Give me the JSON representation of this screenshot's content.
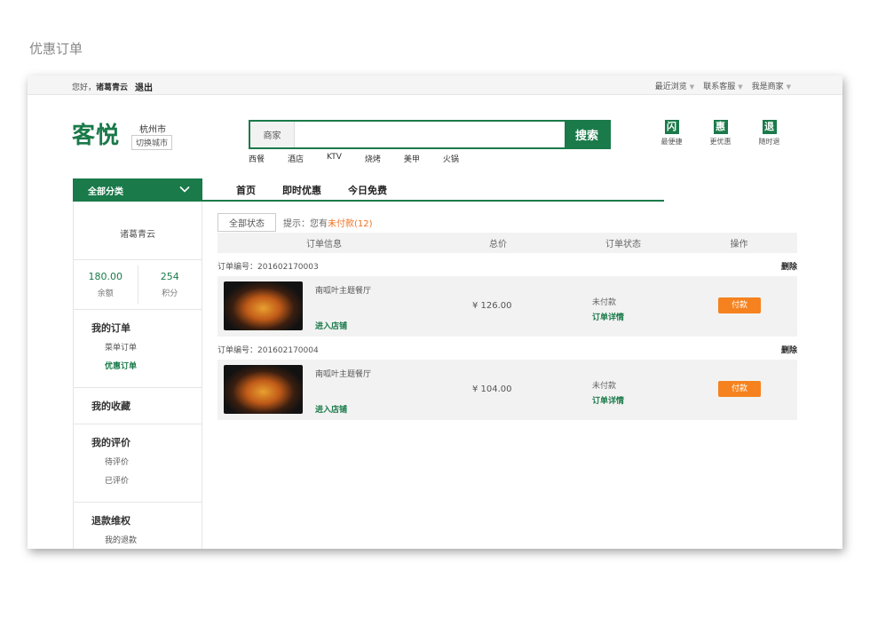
{
  "page_caption": "优惠订单",
  "topbar": {
    "greet_prefix": "您好，",
    "username": "诸葛青云",
    "logout": "退出",
    "links": [
      {
        "label": "最近浏览"
      },
      {
        "label": "联系客服"
      },
      {
        "label": "我是商家"
      }
    ]
  },
  "header": {
    "logo": "客悦",
    "city": "杭州市",
    "city_switch": "切换城市",
    "search": {
      "category": "商家",
      "placeholder": "",
      "button": "搜索"
    },
    "hotwords": [
      "西餐",
      "酒店",
      "KTV",
      "烧烤",
      "美甲",
      "火锅"
    ],
    "badges": [
      {
        "char": "闪",
        "label": "最便捷"
      },
      {
        "char": "惠",
        "label": "更优惠"
      },
      {
        "char": "退",
        "label": "随时退"
      }
    ]
  },
  "nav": {
    "all_categories": "全部分类",
    "items": [
      "首页",
      "即时优惠",
      "今日免费"
    ]
  },
  "sidebar": {
    "username": "诸葛青云",
    "balance_value": "180.00",
    "balance_label": "余额",
    "points_value": "254",
    "points_label": "积分",
    "sections": [
      {
        "title": "我的订单",
        "items": [
          "菜单订单",
          "优惠订单"
        ]
      },
      {
        "title": "我的收藏",
        "items": []
      },
      {
        "title": "我的评价",
        "items": [
          "待评价",
          "已评价"
        ]
      },
      {
        "title": "退款维权",
        "items": [
          "我的退款"
        ]
      }
    ]
  },
  "main": {
    "status_filter": "全部状态",
    "tip_prefix": "提示：您有",
    "tip_highlight": "未付款(12)",
    "columns": [
      "订单信息",
      "总价",
      "订单状态",
      "操作"
    ],
    "orders": [
      {
        "order_no": "订单编号：201602170003",
        "delete": "删除",
        "shop": "南呱叶主题餐厅",
        "shop_link": "进入店铺",
        "price": "¥ 126.00",
        "status": "未付款",
        "detail": "订单详情",
        "action": "付款"
      },
      {
        "order_no": "订单编号：201602170004",
        "delete": "删除",
        "shop": "南呱叶主题餐厅",
        "shop_link": "进入店铺",
        "price": "¥ 104.00",
        "status": "未付款",
        "detail": "订单详情",
        "action": "付款"
      }
    ]
  },
  "colors": {
    "brand_green": "#1a7a4a",
    "pay_orange": "#f5821f",
    "tip_orange": "#f07020"
  }
}
